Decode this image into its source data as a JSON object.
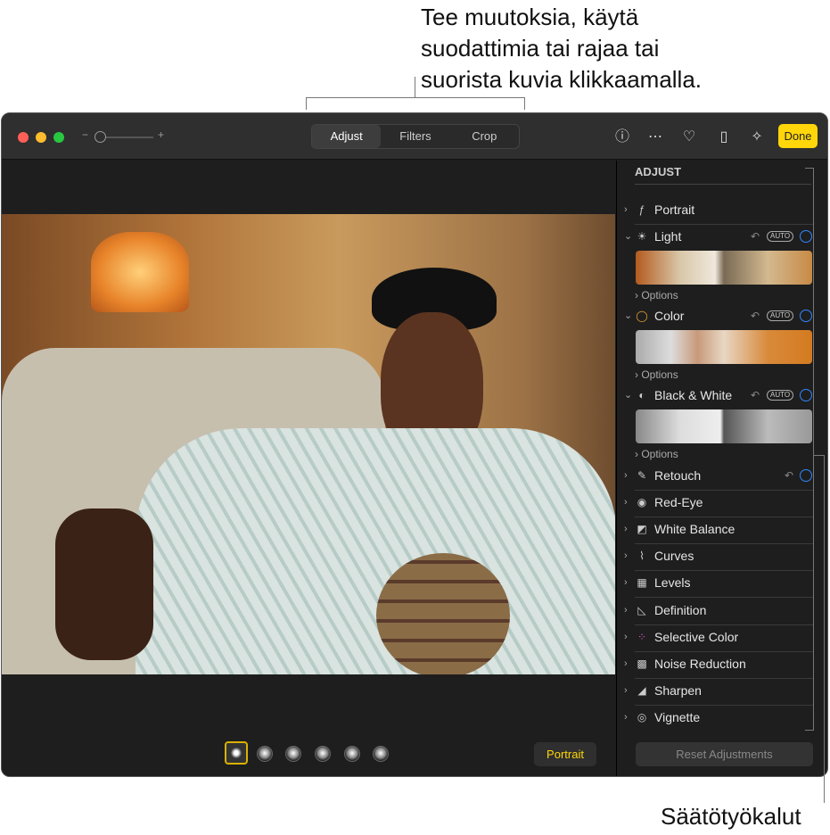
{
  "callout_top": "Tee muutoksia, käytä\nsuodattimia tai rajaa tai\nsuorista kuvia klikkaamalla.",
  "callout_right": "Säätötyökalut",
  "toolbar": {
    "zoom_minus": "−",
    "zoom_plus": "+",
    "tabs": [
      "Adjust",
      "Filters",
      "Crop"
    ],
    "active_tab": "Adjust",
    "done": "Done"
  },
  "colors": {
    "accent": "#ffd60a",
    "blue": "#2f88ff",
    "close": "#ff5f57",
    "min": "#febc2e",
    "max": "#28c840"
  },
  "bottom": {
    "portrait": "Portrait"
  },
  "sidebar": {
    "title": "ADJUST",
    "auto": "AUTO",
    "options": "Options",
    "reset": "Reset Adjustments",
    "items": [
      "Portrait",
      "Light",
      "Color",
      "Black & White",
      "Retouch",
      "Red-Eye",
      "White Balance",
      "Curves",
      "Levels",
      "Definition",
      "Selective Color",
      "Noise Reduction",
      "Sharpen",
      "Vignette"
    ]
  }
}
